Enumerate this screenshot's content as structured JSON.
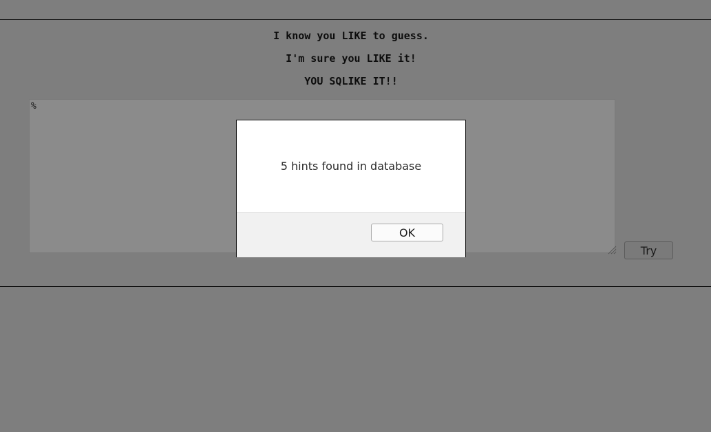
{
  "page": {
    "heading_lines": [
      "I know you LIKE to guess.",
      "I'm sure you LIKE it!",
      "YOU SQLIKE IT!!"
    ]
  },
  "form": {
    "query_value": "%",
    "try_label": "Try"
  },
  "alert": {
    "message": "5 hints found in database",
    "ok_label": "OK"
  }
}
